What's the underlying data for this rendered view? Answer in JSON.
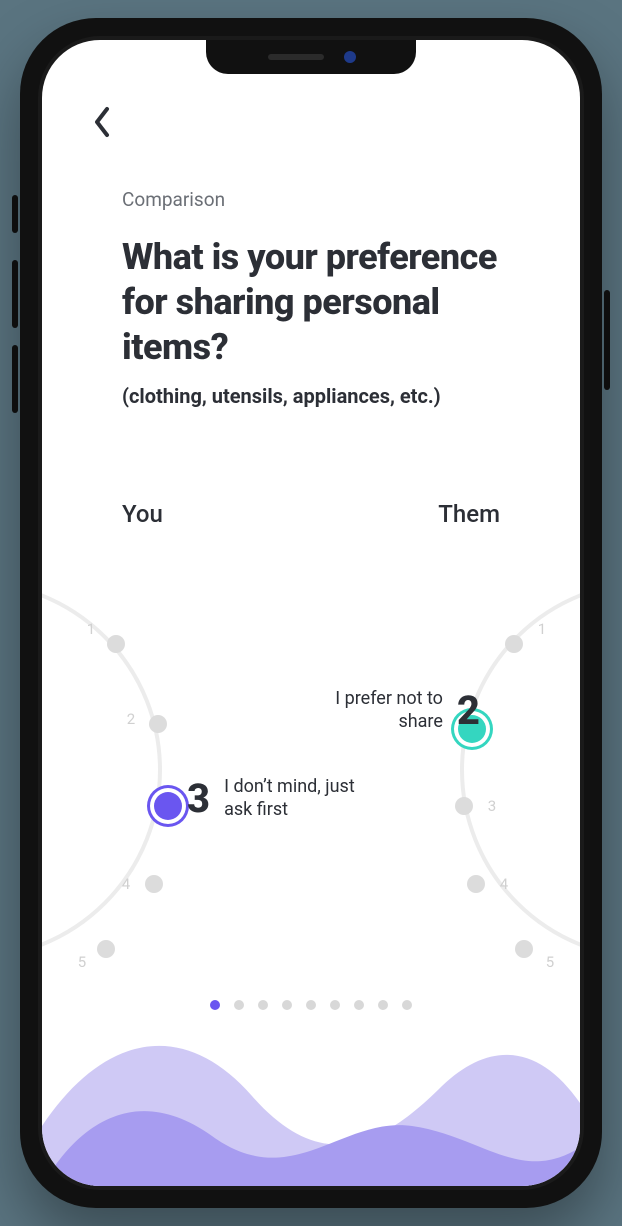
{
  "header": {
    "eyebrow": "Comparison",
    "question": "What is your preference for sharing personal items?",
    "subtitle": "(clothing, utensils, appliances, etc.)"
  },
  "labels": {
    "left": "You",
    "right": "Them"
  },
  "scale": {
    "options": [
      1,
      2,
      3,
      4,
      5
    ]
  },
  "selections": {
    "you": {
      "value": "3",
      "caption": "I don’t mind, just ask first"
    },
    "them": {
      "value": "2",
      "caption": "I prefer not to share"
    }
  },
  "pagination": {
    "total": 9,
    "active_index": 0
  },
  "colors": {
    "you": "#6a56f0",
    "them": "#34d6c0",
    "wave_light": "#cfc9f5",
    "wave_dark": "#a79cf0"
  }
}
